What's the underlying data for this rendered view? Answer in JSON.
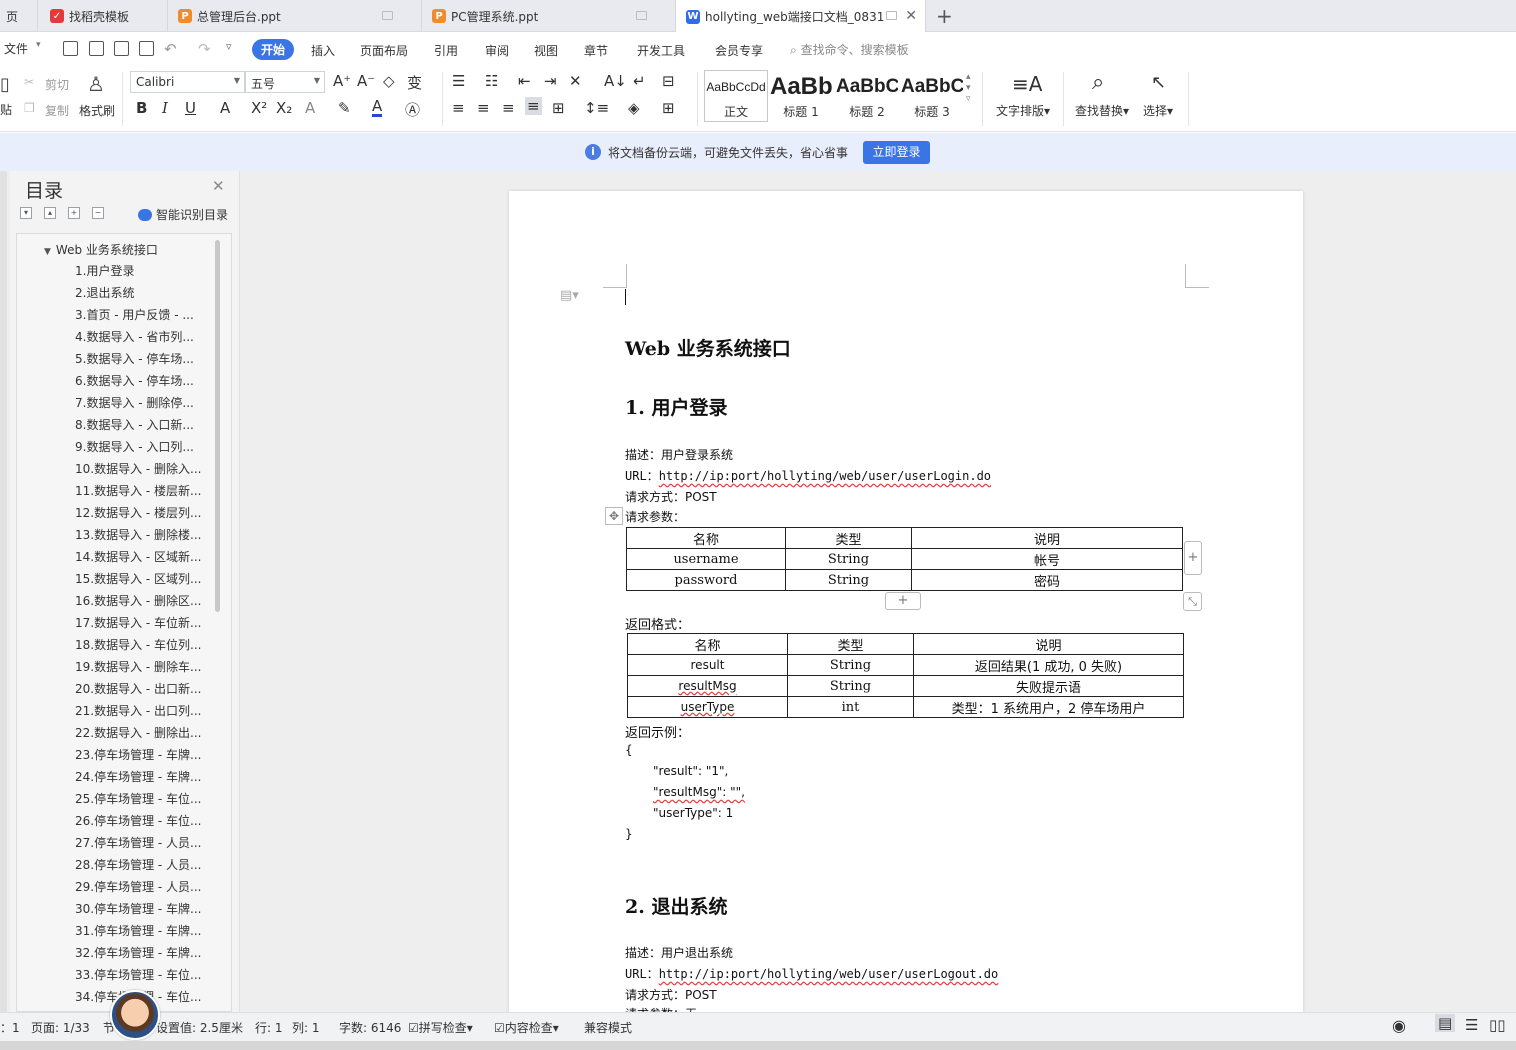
{
  "tabs": [
    {
      "label": "页",
      "icon": ""
    },
    {
      "label": "找稻壳模板",
      "icon": "docer-icon",
      "color": "#e33b3b"
    },
    {
      "label": "总管理后台.ppt",
      "icon": "ppt-icon",
      "color": "#f08c2a"
    },
    {
      "label": "PC管理系统.ppt",
      "icon": "ppt-icon",
      "color": "#f08c2a"
    },
    {
      "label": "hollyting_web端接口文档_0831",
      "icon": "word-icon",
      "color": "#2f6ce5"
    }
  ],
  "menu": {
    "file": "文件",
    "items": [
      "开始",
      "插入",
      "页面布局",
      "引用",
      "审阅",
      "视图",
      "章节",
      "开发工具",
      "会员专享"
    ],
    "search": "查找命令、搜索模板"
  },
  "ribbon": {
    "cut": "剪切",
    "copy": "复制",
    "paste_fragment": "贴",
    "format_painter": "格式刷",
    "font": "Calibri",
    "size": "五号",
    "styles": [
      {
        "sample": "AaBbCcDd",
        "label": "正文"
      },
      {
        "sample": "AaBb",
        "label": "标题 1"
      },
      {
        "sample": "AaBbC",
        "label": "标题 2"
      },
      {
        "sample": "AaBbC",
        "label": "标题 3"
      }
    ],
    "text_layout": "文字排版",
    "find_replace": "查找替换",
    "select": "选择"
  },
  "notice": {
    "message": "将文档备份云端，可避免文件丢失，省心省事",
    "button": "立即登录"
  },
  "nav": {
    "title": "目录",
    "smart": "智能识别目录",
    "root": "Web 业务系统接口",
    "items": [
      "1.用户登录",
      "2.退出系统",
      "3.首页 - 用户反馈 - ...",
      "4.数据导入 - 省市列...",
      "5.数据导入 - 停车场...",
      "6.数据导入 - 停车场...",
      "7.数据导入 - 删除停...",
      "8.数据导入 - 入口新...",
      "9.数据导入 - 入口列...",
      "10.数据导入 - 删除入...",
      "11.数据导入 - 楼层新...",
      "12.数据导入 - 楼层列...",
      "13.数据导入 - 删除楼...",
      "14.数据导入 - 区域新...",
      "15.数据导入 - 区域列...",
      "16.数据导入 - 删除区...",
      "17.数据导入 - 车位新...",
      "18.数据导入 - 车位列...",
      "19.数据导入 - 删除车...",
      "20.数据导入 - 出口新...",
      "21.数据导入 - 出口列...",
      "22.数据导入 - 删除出...",
      "23.停车场管理 - 车牌...",
      "24.停车场管理 - 车牌...",
      "25.停车场管理 - 车位...",
      "26.停车场管理 - 车位...",
      "27.停车场管理 - 人员...",
      "28.停车场管理 - 人员...",
      "29.停车场管理 - 人员...",
      "30.停车场管理 - 车牌...",
      "31.停车场管理 - 车牌...",
      "32.停车场管理 - 车牌...",
      "33.停车场管理 - 车位...",
      "34.停车场管理 - 车位..."
    ]
  },
  "doc": {
    "title": "Web 业务系统接口",
    "section1": {
      "heading": "1.  用户登录",
      "desc": "描述：用户登录系统",
      "url_prefix": "URL：",
      "url_link": "http://ip:port/hollyting/web/user/userLogin.do",
      "method": "请求方式：POST",
      "params_label": "请求参数：",
      "params_header": [
        "名称",
        "类型",
        "说明"
      ],
      "params_rows": [
        [
          "username",
          "String",
          "帐号"
        ],
        [
          "password",
          "String",
          "密码"
        ]
      ],
      "return_label": "返回格式：",
      "return_header": [
        "名称",
        "类型",
        "说明"
      ],
      "return_rows": [
        [
          "result",
          "String",
          "返回结果(1 成功, 0 失败)"
        ],
        [
          "resultMsg",
          "String",
          "失败提示语"
        ],
        [
          "userType",
          "int",
          "类型：1 系统用户，2 停车场用户"
        ]
      ],
      "example_label": "返回示例：",
      "example_lines": [
        "{",
        "\"result\": \"1\",",
        "\"resultMsg\": \"\",",
        "\"userType\": 1",
        "}"
      ]
    },
    "section2": {
      "heading": "2.  退出系统",
      "desc": "描述：用户退出系统",
      "url_prefix": "URL：",
      "url_link": "http://ip:port/hollyting/web/user/userLogout.do",
      "method": "请求方式：POST",
      "params_partial": "请求参数：无"
    }
  },
  "status": {
    "section": "：1",
    "page": "页面: 1/33",
    "setting_prefix": "节",
    "setting": "设置值: 2.5厘米",
    "row": "行: 1",
    "col": "列: 1",
    "words": "字数: 6146",
    "spell": "拼写检查",
    "content": "内容检查",
    "compat": "兼容模式"
  }
}
